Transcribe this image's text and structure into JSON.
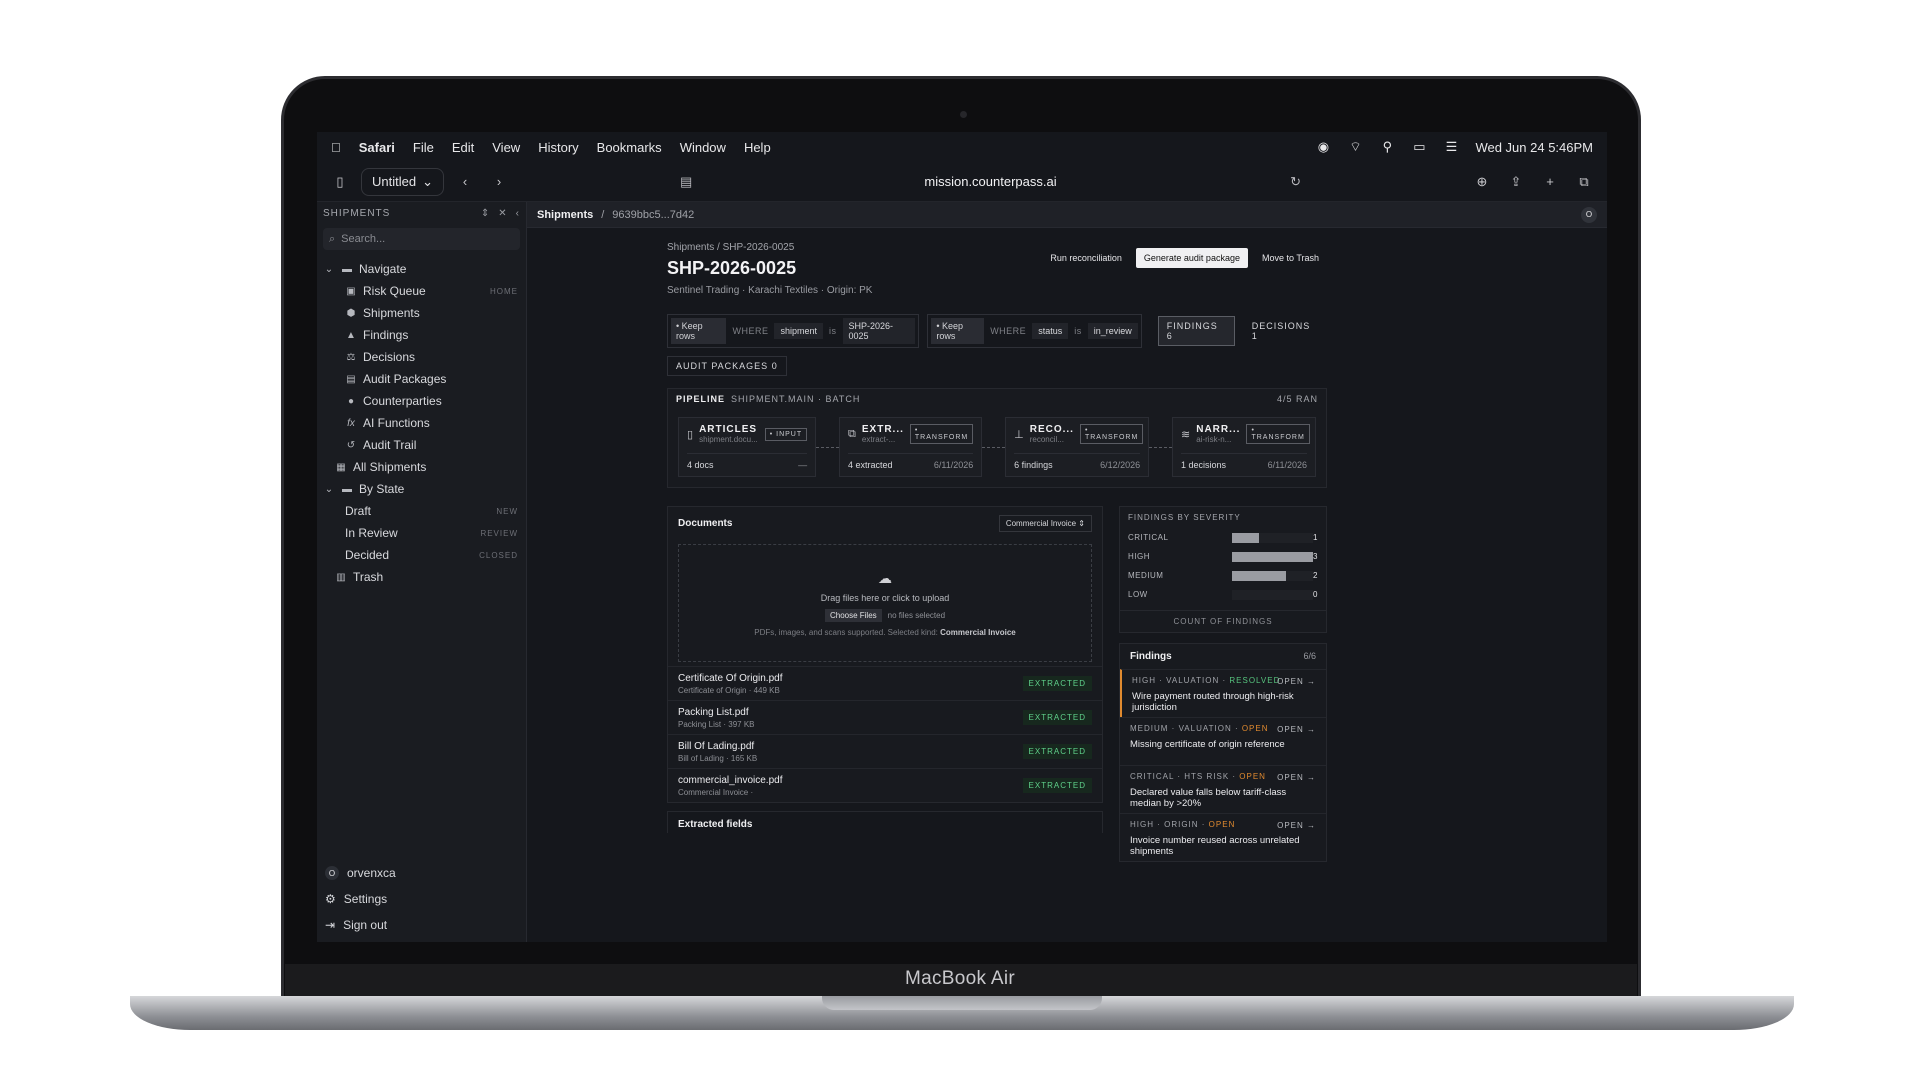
{
  "device": {
    "label": "MacBook Air"
  },
  "menubar": {
    "app": "Safari",
    "items": [
      "File",
      "Edit",
      "View",
      "History",
      "Bookmarks",
      "Window",
      "Help"
    ],
    "datetime": "Wed Jun 24  5:46PM"
  },
  "browser": {
    "tab_title": "Untitled",
    "url": "mission.counterpass.ai"
  },
  "sidebar": {
    "title": "SHIPMENTS",
    "search_placeholder": "Search...",
    "navigate_label": "Navigate",
    "nav": [
      {
        "label": "Risk Queue",
        "tag": "HOME",
        "icon": "queue-icon"
      },
      {
        "label": "Shipments",
        "tag": "",
        "icon": "box-icon"
      },
      {
        "label": "Findings",
        "tag": "",
        "icon": "warning-icon"
      },
      {
        "label": "Decisions",
        "tag": "",
        "icon": "gavel-icon"
      },
      {
        "label": "Audit Packages",
        "tag": "",
        "icon": "package-icon"
      },
      {
        "label": "Counterparties",
        "tag": "",
        "icon": "people-icon"
      },
      {
        "label": "AI Functions",
        "tag": "",
        "icon": "function-icon"
      },
      {
        "label": "Audit Trail",
        "tag": "",
        "icon": "history-icon"
      }
    ],
    "all_shipments": "All Shipments",
    "by_state_label": "By State",
    "states": [
      {
        "label": "Draft",
        "tag": "NEW"
      },
      {
        "label": "In Review",
        "tag": "REVIEW"
      },
      {
        "label": "Decided",
        "tag": "CLOSED"
      }
    ],
    "trash": "Trash",
    "user": {
      "initial": "O",
      "name": "orvenxca"
    },
    "settings": "Settings",
    "signout": "Sign out"
  },
  "crumbbar": {
    "section": "Shipments",
    "id": "9639bbc5...7d42",
    "avatar": "O"
  },
  "shipment": {
    "breadcrumb": "Shipments / SHP-2026-0025",
    "title": "SHP-2026-0025",
    "subtitle": "Sentinel Trading · Karachi Textiles · Origin: PK",
    "actions": {
      "reconcile": "Run reconciliation",
      "generate": "Generate audit package",
      "trash": "Move to Trash"
    }
  },
  "filters": [
    {
      "chip": "• Keep rows",
      "where": "WHERE",
      "field": "shipment",
      "op": "is",
      "value": "SHP-2026-0025"
    },
    {
      "chip": "• Keep rows",
      "where": "WHERE",
      "field": "status",
      "op": "is",
      "value": "in_review"
    }
  ],
  "counts": {
    "findings": "FINDINGS  6",
    "decisions": "DECISIONS  1",
    "audit_packages": "AUDIT PACKAGES  0"
  },
  "pipeline": {
    "label": "PIPELINE",
    "source": "SHIPMENT.MAIN · BATCH",
    "ran": "4/5 RAN",
    "nodes": [
      {
        "name": "ARTICLES",
        "sub": "shipment.docu...",
        "kind": "• INPUT",
        "count": "4 docs",
        "date": "—",
        "icon": "document-icon"
      },
      {
        "name": "EXTR...",
        "sub": "extract-...",
        "kind": "• TRANSFORM",
        "count": "4 extracted",
        "date": "6/11/2026",
        "icon": "copy-icon"
      },
      {
        "name": "RECO...",
        "sub": "reconcil...",
        "kind": "• TRANSFORM",
        "count": "6 findings",
        "date": "6/12/2026",
        "icon": "hierarchy-icon"
      },
      {
        "name": "NARR...",
        "sub": "ai-risk-n...",
        "kind": "• TRANSFORM",
        "count": "1 decisions",
        "date": "6/11/2026",
        "icon": "wand-icon"
      }
    ]
  },
  "documents": {
    "title": "Documents",
    "kind_select": "Commercial Invoice",
    "dropzone": {
      "text": "Drag files here or click to upload",
      "choose": "Choose Files",
      "none": "no files selected",
      "hint_prefix": "PDFs, images, and scans supported. Selected kind:",
      "hint_kind": "Commercial Invoice"
    },
    "files": [
      {
        "name": "Certificate Of Origin.pdf",
        "meta": "Certificate of Origin · 449 KB",
        "status": "EXTRACTED"
      },
      {
        "name": "Packing List.pdf",
        "meta": "Packing List · 397 KB",
        "status": "EXTRACTED"
      },
      {
        "name": "Bill Of Lading.pdf",
        "meta": "Bill of Lading · 165 KB",
        "status": "EXTRACTED"
      },
      {
        "name": "commercial_invoice.pdf",
        "meta": "Commercial Invoice ·",
        "status": "EXTRACTED"
      }
    ],
    "extracted_fields": "Extracted fields"
  },
  "severity": {
    "title": "FINDINGS BY SEVERITY",
    "footer": "COUNT OF FINDINGS",
    "max": 3,
    "rows": [
      {
        "label": "CRITICAL",
        "count": 1
      },
      {
        "label": "HIGH",
        "count": 3
      },
      {
        "label": "MEDIUM",
        "count": 2
      },
      {
        "label": "LOW",
        "count": 0
      }
    ]
  },
  "findings": {
    "title": "Findings",
    "count": "6/6",
    "items": [
      {
        "sev": "HIGH",
        "cat": "VALUATION",
        "state": "RESOLVED",
        "text": "Wire payment routed through high-risk jurisdiction",
        "go": "OPEN →"
      },
      {
        "sev": "MEDIUM",
        "cat": "VALUATION",
        "state": "OPEN",
        "text": "Missing certificate of origin reference",
        "go": "OPEN →"
      },
      {
        "sev": "CRITICAL",
        "cat": "HTS RISK",
        "state": "OPEN",
        "text": "Declared value falls below tariff-class median by >20%",
        "go": "OPEN →"
      },
      {
        "sev": "HIGH",
        "cat": "ORIGIN",
        "state": "OPEN",
        "text": "Invoice number reused across unrelated shipments",
        "go": "OPEN →"
      }
    ]
  }
}
